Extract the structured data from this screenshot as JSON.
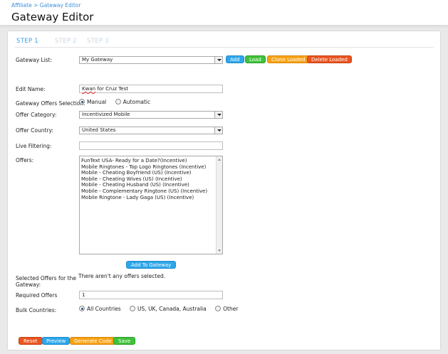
{
  "breadcrumb": {
    "root": "Affiliate",
    "separator": " > ",
    "current": "Gateway Editor"
  },
  "page_title": "Gateway Editor",
  "steps": [
    {
      "label": "STEP 1",
      "active": true
    },
    {
      "label": "STEP 2",
      "active": false
    },
    {
      "label": "STEP 3",
      "active": false
    }
  ],
  "gateway_list": {
    "label": "Gateway List:",
    "selected": "My Gateway",
    "buttons": {
      "add": "Add",
      "load": "Load",
      "clone": "Clone Loaded",
      "delete": "Delete Loaded"
    }
  },
  "edit_name": {
    "label": "Edit Name:",
    "value_prefix": "Kwan",
    "value_suffix": " for Cruz Test"
  },
  "offers_selection": {
    "label": "Gateway Offers Selection:",
    "options": [
      "Manual",
      "Automatic"
    ],
    "selected": "Manual"
  },
  "offer_category": {
    "label": "Offer Category:",
    "selected": "Incentivized Mobile"
  },
  "offer_country": {
    "label": "Offer Country:",
    "selected": "United States"
  },
  "live_filtering": {
    "label": "Live Filtering:",
    "value": ""
  },
  "offers": {
    "label": "Offers:",
    "items": [
      "FunText USA- Ready for a Date?(Incentive)",
      "Mobile Ringtones - Top Logo Ringtones (Incentive)",
      "Mobile - Cheating Boyfriend (US) (Incentive)",
      "Mobile - Cheating Wives (US) (Incentive)",
      "Mobile - Cheating Husband (US) (Incentive)",
      "Mobile - Complementary Ringtone (US) (Incentive)",
      "Mobile Ringtone - Lady Gaga (US) (Incentive)"
    ],
    "add_button": "Add To Gateway"
  },
  "selected_offers": {
    "label_line1": "Selected Offers for the",
    "label_line2": "Gateway:",
    "message": "There aren't any offers selected."
  },
  "required_offers": {
    "label": "Required Offers",
    "value": "1"
  },
  "bulk_countries": {
    "label": "Bulk Countries:",
    "options": [
      "All Countries",
      "US, UK, Canada, Australia",
      "Other"
    ],
    "selected": "All Countries"
  },
  "footer_buttons": {
    "reset": "Reset",
    "preview": "Preview",
    "generate": "Generate Code",
    "save": "Save"
  },
  "colors": {
    "blue": "#2ea7ea",
    "green": "#3fc23a",
    "orange": "#f7a215",
    "red": "#ea5520",
    "step_active": "#3aa0e6"
  }
}
